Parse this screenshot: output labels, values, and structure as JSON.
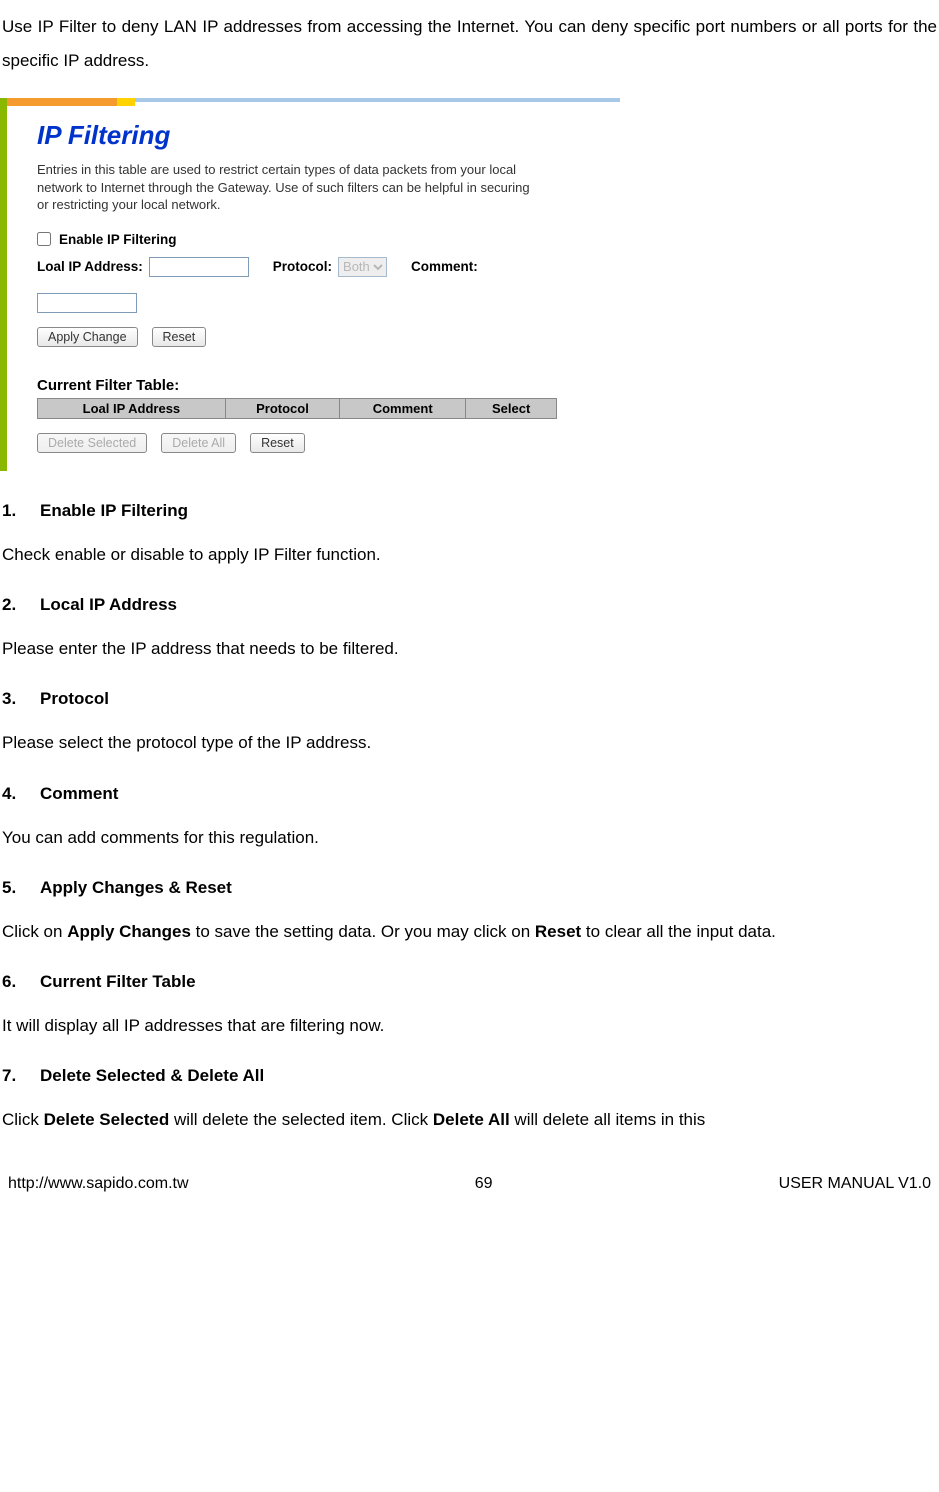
{
  "intro": "Use IP Filter to deny LAN IP addresses from accessing the Internet. You can deny specific port numbers or all ports for the specific IP address.",
  "screenshot": {
    "title": "IP Filtering",
    "desc": "Entries in this table are used to restrict certain types of data packets from your local network to Internet through the Gateway. Use of such filters can be helpful in securing or restricting your local network.",
    "enable_label": "Enable IP Filtering",
    "local_ip_label": "Loal IP Address:",
    "protocol_label": "Protocol:",
    "protocol_value": "Both",
    "comment_label": "Comment:",
    "apply_btn": "Apply Change",
    "reset_btn": "Reset",
    "current_table_title": "Current Filter Table:",
    "cols": [
      "Loal IP Address",
      "Protocol",
      "Comment",
      "Select"
    ],
    "delete_sel_btn": "Delete Selected",
    "delete_all_btn": "Delete All",
    "reset2_btn": "Reset"
  },
  "items": [
    {
      "num": "1.",
      "title": "Enable IP Filtering",
      "body": "Check enable or disable to apply IP Filter function."
    },
    {
      "num": "2.",
      "title": "Local IP Address",
      "body": "Please enter the IP address that needs to be filtered."
    },
    {
      "num": "3.",
      "title": "Protocol",
      "body": "Please select the protocol type of the IP address."
    },
    {
      "num": "4.",
      "title": "Comment",
      "body": "You can add comments for this regulation."
    },
    {
      "num": "5.",
      "title": "Apply Changes & Reset",
      "body_pre": "Click on ",
      "b1": "Apply Changes",
      "body_mid": " to save the setting data. Or you may click on ",
      "b2": "Reset",
      "body_post": " to clear all the input data."
    },
    {
      "num": "6.",
      "title": "Current Filter Table",
      "body": "It will display all IP addresses that are filtering now."
    },
    {
      "num": "7.",
      "title": "Delete Selected & Delete All",
      "body_pre": "Click ",
      "b1": "Delete Selected",
      "body_mid": " will delete the selected item. Click ",
      "b2": "Delete All",
      "body_post": " will delete all items in this"
    }
  ],
  "footer": {
    "url": "http://www.sapido.com.tw",
    "page": "69",
    "manual": "USER MANUAL V1.0"
  }
}
